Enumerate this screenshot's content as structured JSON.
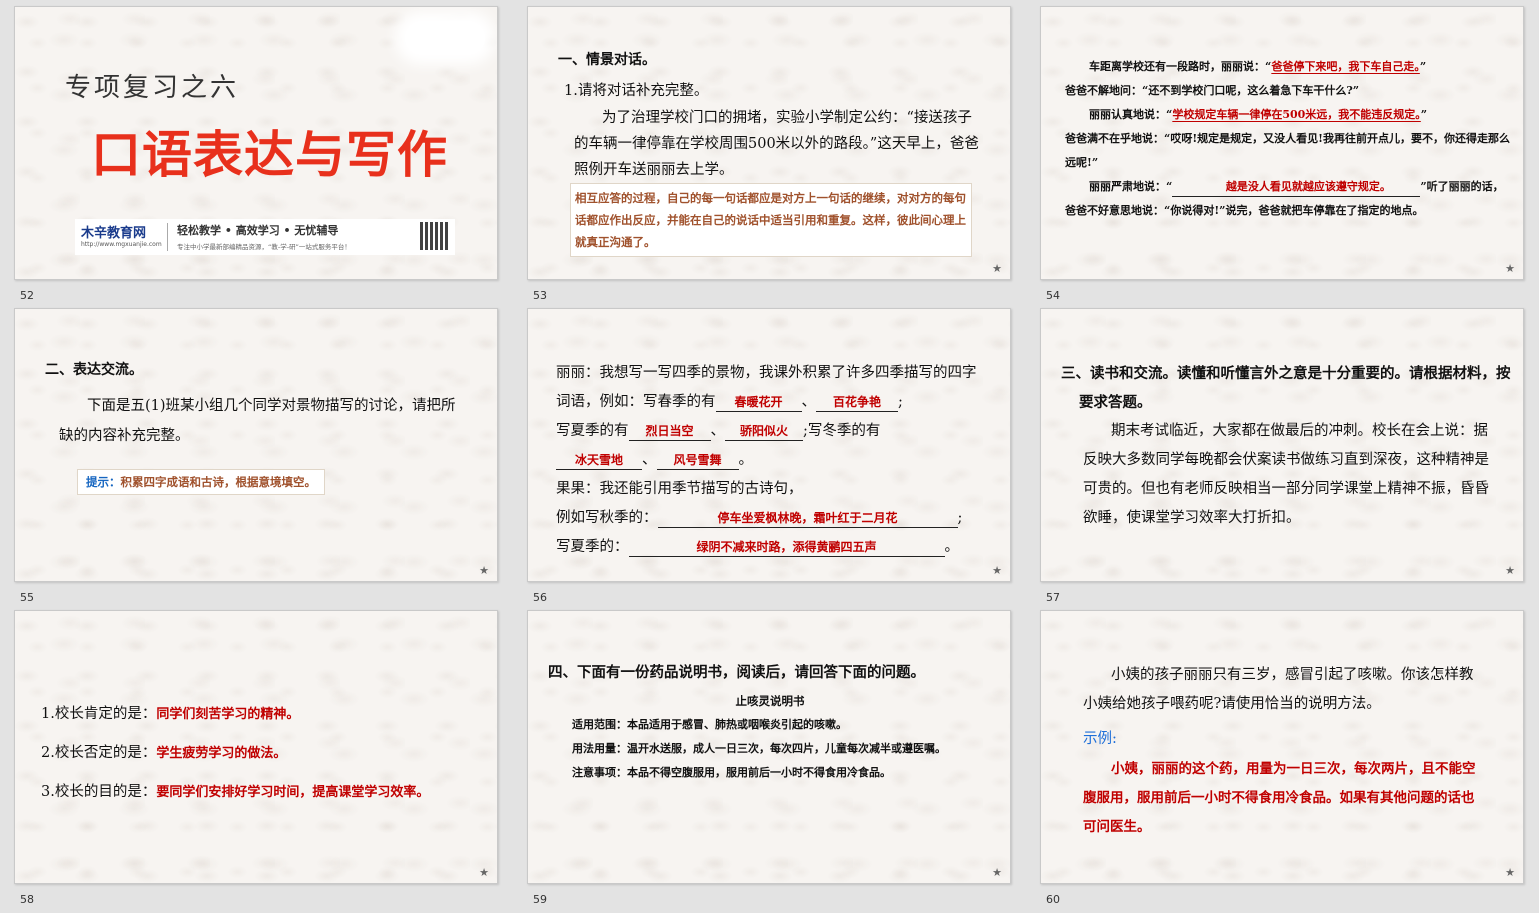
{
  "slides": [
    {
      "number": "52",
      "subtitle": "专项复习之六",
      "title": "口语表达与写作",
      "brand_name": "木辛教育网",
      "brand_url": "http://www.mgxuanjie.com",
      "slogan": "轻松教学 • 高效学习 • 无忧辅导",
      "slogan_sub": "专注中小学最新部编精品资源，“教-学-研”一站式服务平台！"
    },
    {
      "number": "53",
      "heading": "一、情景对话。",
      "q1": "1.请将对话补充完整。",
      "para": "为了治理学校门口的拥堵，实验小学制定公约：“接送孩子的车辆一律停靠在学校周围500米以外的路段。”这天早上，爸爸照例开车送丽丽去上学。",
      "hint": "相互应答的过程，自己的每一句话都应是对方上一句话的继续，对对方的每句话都应作出反应，并能在自己的说话中适当引用和重复。这样，彼此间心理上就真正沟通了。"
    },
    {
      "number": "54",
      "l1a": "车距离学校还有一段路时，丽丽说：“",
      "l1ans": "爸爸停下来吧，我下车自己走。",
      "l1b": "”",
      "l2": "爸爸不解地问：“还不到学校门口呢，这么着急下车干什么?”",
      "l3a": "丽丽认真地说：“",
      "l3ans": "学校规定车辆一律停在500米远，我不能违反规定。",
      "l3b": "”",
      "l4": "爸爸满不在乎地说：“哎呀!规定是规定，又没人看见!我再往前开点儿，要不，你还得走那么远呢!”",
      "l5a": "丽丽严肃地说：“",
      "l5ans": "越是没人看见就越应该遵守规定。",
      "l5b": "”听了丽丽的话，爸爸不好意思地说：“你说得对!”说完，爸爸就把车停靠在了指定的地点。"
    },
    {
      "number": "55",
      "heading": "二、表达交流。",
      "para": "下面是五(1)班某小组几个同学对景物描写的讨论，请把所缺的内容补充完整。",
      "hint_label": "提示：",
      "hint_text": "积累四字成语和古诗，根据意境填空。"
    },
    {
      "number": "56",
      "p1": "丽丽：我想写一写四季的景物，我课外积累了许多四季描写的四字词语，例如：写春季的有",
      "spring1": "春暖花开",
      "spring2": "百花争艳",
      "summer_label": "写夏季的有",
      "summer1": "烈日当空",
      "summer2": "骄阳似火",
      "winter_label": ";写冬季的有",
      "winter1": "冰天雪地",
      "winter2": "风号雪舞",
      "p2": "果果：我还能引用季节描写的古诗句，",
      "autumn_label": "例如写秋季的：",
      "autumn": "停车坐爱枫林晚，霜叶红于二月花",
      "summer_poem_label": "写夏季的：",
      "summer_poem": "绿阴不减来时路，添得黄鹂四五声",
      "sep": "、",
      "semi": ";",
      "period": "。"
    },
    {
      "number": "57",
      "heading": "三、读书和交流。读懂和听懂言外之意是十分重要的。请根据材料，按要求答题。",
      "para": "期末考试临近，大家都在做最后的冲刺。校长在会上说：据反映大多数同学每晚都会伏案读书做练习直到深夜，这种精神是可贵的。但也有老师反映相当一部分同学课堂上精神不振，昏昏欲睡，使课堂学习效率大打折扣。"
    },
    {
      "number": "58",
      "q1": "1.校长肯定的是：",
      "a1": "同学们刻苦学习的精神。",
      "q2": "2.校长否定的是：",
      "a2": "学生疲劳学习的做法。",
      "q3": "3.校长的目的是：",
      "a3": "要同学们安排好学习时间，提高课堂学习效率。"
    },
    {
      "number": "59",
      "heading": "四、下面有一份药品说明书，阅读后，请回答下面的问题。",
      "doc_title": "止咳灵说明书",
      "scope": "适用范围：本品适用于感冒、肺热或咽喉炎引起的咳嗽。",
      "dosage": "用法用量：温开水送服，成人一日三次，每次四片，儿童每次减半或遵医嘱。",
      "note": "注意事项：本品不得空腹服用，服用前后一小时不得食用冷食品。"
    },
    {
      "number": "60",
      "para": "小姨的孩子丽丽只有三岁，感冒引起了咳嗽。你该怎样教小姨给她孩子喂药呢?请使用恰当的说明方法。",
      "example_label": "示例:",
      "example": "小姨，丽丽的这个药，用量为一日三次，每次两片，且不能空腹服用，服用前后一小时不得食用冷食品。如果有其他问题的话也可问医生。"
    }
  ],
  "star_icon": "★",
  "colors": {
    "answer_red": "#c00000",
    "title_red": "#e8301c",
    "hint_brown": "#a0522d",
    "hint_blue": "#1565c0",
    "example_blue": "#1e6fd9"
  }
}
